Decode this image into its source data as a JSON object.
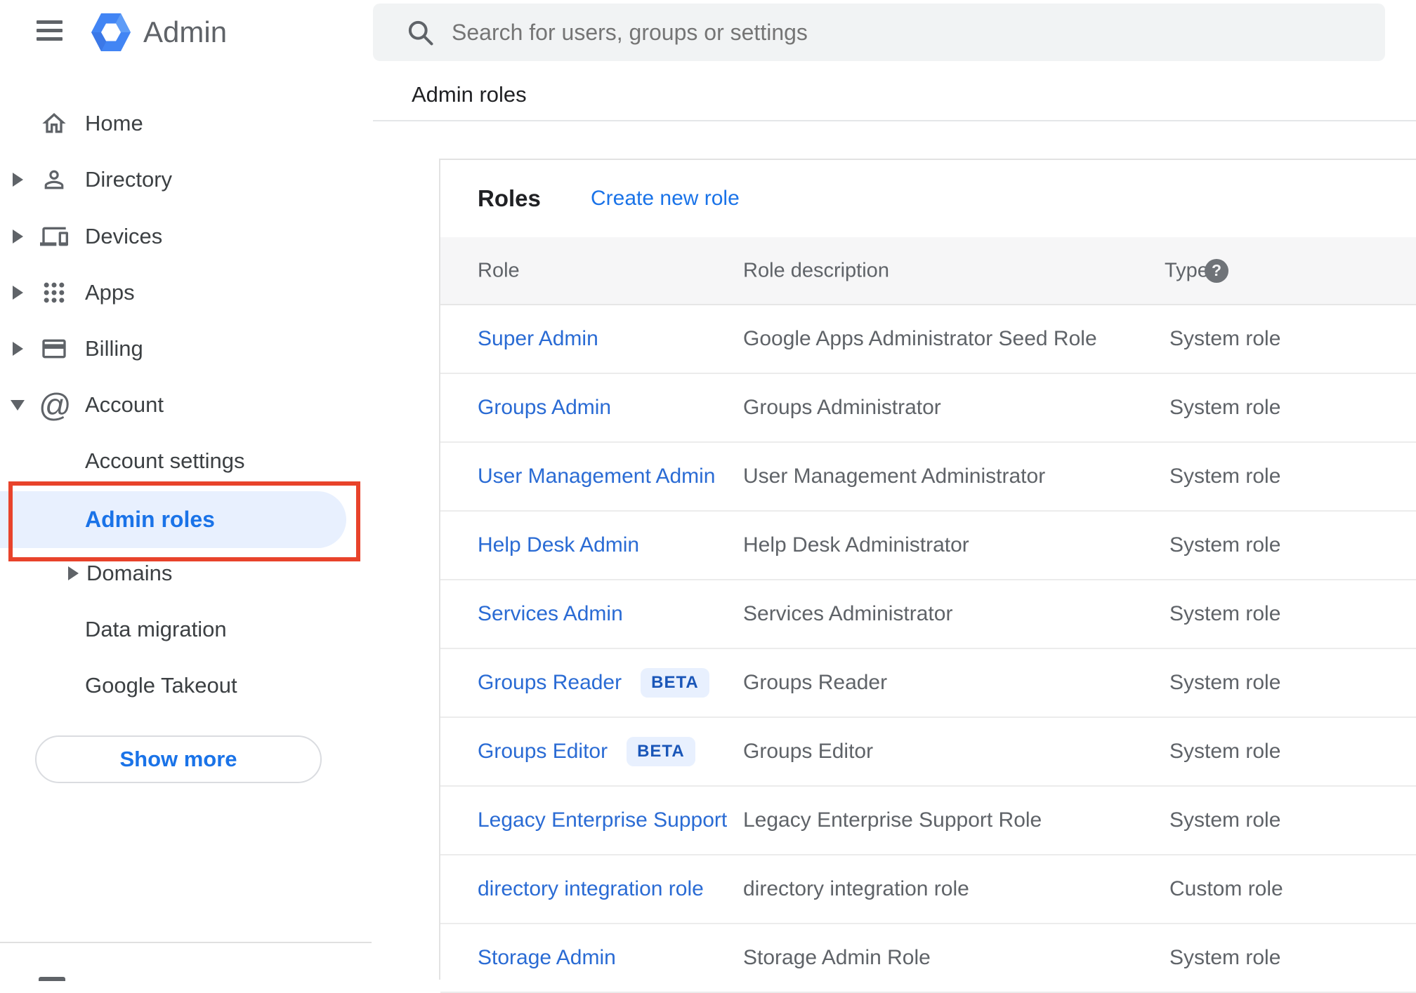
{
  "topbar": {
    "product_name": "Admin",
    "search_placeholder": "Search for users, groups or settings"
  },
  "breadcrumb": "Admin roles",
  "sidebar": {
    "items": [
      {
        "label": "Home",
        "expandable": false
      },
      {
        "label": "Directory",
        "expandable": true
      },
      {
        "label": "Devices",
        "expandable": true
      },
      {
        "label": "Apps",
        "expandable": true
      },
      {
        "label": "Billing",
        "expandable": true
      },
      {
        "label": "Account",
        "expandable": true,
        "expanded": true
      }
    ],
    "account_sub_items": [
      {
        "label": "Account settings"
      },
      {
        "label": "Admin roles",
        "selected": true
      },
      {
        "label": "Domains",
        "expandable": true
      },
      {
        "label": "Data migration"
      },
      {
        "label": "Google Takeout"
      }
    ],
    "show_more_label": "Show more"
  },
  "card": {
    "title": "Roles",
    "create_link_label": "Create new role",
    "table": {
      "columns": [
        "Role",
        "Role description",
        "Type"
      ],
      "help_glyph": "?",
      "rows": [
        {
          "role": "Super Admin",
          "description": "Google Apps Administrator Seed Role",
          "type": "System role"
        },
        {
          "role": "Groups Admin",
          "description": "Groups Administrator",
          "type": "System role"
        },
        {
          "role": "User Management Admin",
          "description": "User Management Administrator",
          "type": "System role"
        },
        {
          "role": "Help Desk Admin",
          "description": "Help Desk Administrator",
          "type": "System role"
        },
        {
          "role": "Services Admin",
          "description": "Services Administrator",
          "type": "System role"
        },
        {
          "role": "Groups Reader",
          "beta_label": "BETA",
          "description": "Groups Reader",
          "type": "System role"
        },
        {
          "role": "Groups Editor",
          "beta_label": "BETA",
          "description": "Groups Editor",
          "type": "System role"
        },
        {
          "role": "Legacy Enterprise Support",
          "description": "Legacy Enterprise Support Role",
          "type": "System role"
        },
        {
          "role": "directory integration role",
          "description": "directory integration role",
          "type": "Custom role"
        },
        {
          "role": "Storage Admin",
          "description": "Storage Admin Role",
          "type": "System role"
        }
      ]
    }
  },
  "colors": {
    "accent_blue": "#1a73e8",
    "link_blue": "#2a6bd4",
    "selected_bg": "#e8f0fe",
    "annotation_red": "#e8432b",
    "icon_gray": "#5f6368",
    "text_dark": "#202124",
    "header_band_bg": "#f6f6f7"
  }
}
